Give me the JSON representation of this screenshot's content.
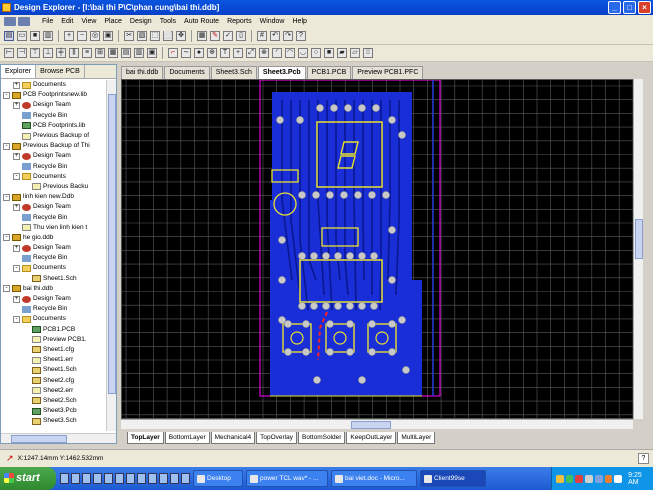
{
  "window": {
    "title": "Design Explorer - [I:\\bai thi P\\C\\phan cung\\bai thi.ddb]",
    "min": "_",
    "max": "□",
    "close": "×"
  },
  "menu": [
    "File",
    "Edit",
    "View",
    "Place",
    "Design",
    "Tools",
    "Auto Route",
    "Reports",
    "Window",
    "Help"
  ],
  "panel": {
    "tabs": [
      "Explorer",
      "Browse PCB"
    ],
    "tree": [
      {
        "indent": 1,
        "exp": "+",
        "icon": "folder",
        "label": "Documents"
      },
      {
        "indent": 0,
        "exp": "-",
        "icon": "ddb",
        "label": "PCB Footprintsnew.lib"
      },
      {
        "indent": 1,
        "exp": "+",
        "icon": "team",
        "label": "Design Team"
      },
      {
        "indent": 1,
        "exp": "",
        "icon": "bin",
        "label": "Recycle Bin"
      },
      {
        "indent": 1,
        "exp": "",
        "icon": "pcb",
        "label": "PCB Footprints.lib"
      },
      {
        "indent": 1,
        "exp": "",
        "icon": "doc",
        "label": "Previous Backup of"
      },
      {
        "indent": 0,
        "exp": "-",
        "icon": "ddb",
        "label": "Previous Backup of Thi"
      },
      {
        "indent": 1,
        "exp": "+",
        "icon": "team",
        "label": "Design Team"
      },
      {
        "indent": 1,
        "exp": "",
        "icon": "bin",
        "label": "Recycle Bin"
      },
      {
        "indent": 1,
        "exp": "-",
        "icon": "folder",
        "label": "Documents"
      },
      {
        "indent": 2,
        "exp": "",
        "icon": "doc",
        "label": "Previous Backu"
      },
      {
        "indent": 0,
        "exp": "-",
        "icon": "ddb",
        "label": "linh kien new.Ddb"
      },
      {
        "indent": 1,
        "exp": "+",
        "icon": "team",
        "label": "Design Team"
      },
      {
        "indent": 1,
        "exp": "",
        "icon": "bin",
        "label": "Recycle Bin"
      },
      {
        "indent": 1,
        "exp": "",
        "icon": "doc",
        "label": "Thu vien linh kien t"
      },
      {
        "indent": 0,
        "exp": "-",
        "icon": "ddb",
        "label": "he gio.ddb"
      },
      {
        "indent": 1,
        "exp": "+",
        "icon": "team",
        "label": "Design Team"
      },
      {
        "indent": 1,
        "exp": "",
        "icon": "bin",
        "label": "Recycle Bin"
      },
      {
        "indent": 1,
        "exp": "-",
        "icon": "folder",
        "label": "Documents"
      },
      {
        "indent": 2,
        "exp": "",
        "icon": "sch",
        "label": "Sheet1.Sch"
      },
      {
        "indent": 0,
        "exp": "-",
        "icon": "ddb",
        "label": "bai thi.ddb"
      },
      {
        "indent": 1,
        "exp": "+",
        "icon": "team",
        "label": "Design Team"
      },
      {
        "indent": 1,
        "exp": "",
        "icon": "bin",
        "label": "Recycle Bin"
      },
      {
        "indent": 1,
        "exp": "-",
        "icon": "folder",
        "label": "Documents"
      },
      {
        "indent": 2,
        "exp": "",
        "icon": "pcb",
        "label": "PCB1.PCB"
      },
      {
        "indent": 2,
        "exp": "",
        "icon": "doc",
        "label": "Preview PCB1."
      },
      {
        "indent": 2,
        "exp": "",
        "icon": "sch",
        "label": "Sheet1.cfg"
      },
      {
        "indent": 2,
        "exp": "",
        "icon": "doc",
        "label": "Sheet1.err"
      },
      {
        "indent": 2,
        "exp": "",
        "icon": "sch",
        "label": "Sheet1.Sch"
      },
      {
        "indent": 2,
        "exp": "",
        "icon": "sch",
        "label": "Sheet2.cfg"
      },
      {
        "indent": 2,
        "exp": "",
        "icon": "doc",
        "label": "Sheet2.err"
      },
      {
        "indent": 2,
        "exp": "",
        "icon": "sch",
        "label": "Sheet2.Sch"
      },
      {
        "indent": 2,
        "exp": "",
        "icon": "pcb",
        "label": "Sheet3.Pcb"
      },
      {
        "indent": 2,
        "exp": "",
        "icon": "sch",
        "label": "Sheet3.Sch"
      }
    ]
  },
  "doc_tabs": [
    "bai thi.ddb",
    "Documents",
    "Sheet3.Sch",
    "Sheet3.Pcb",
    "PCB1.PCB",
    "Preview PCB1.PFC"
  ],
  "active_doc_tab": 3,
  "layer_tabs": [
    "TopLayer",
    "BottomLayer",
    "Mechanical4",
    "TopOverlay",
    "BottomSolder",
    "KeepOutLayer",
    "MultiLayer"
  ],
  "status": {
    "coords": "X:1247.14mm Y:1462.532mm"
  },
  "taskbar": {
    "start": "start",
    "items": [
      "Desktop",
      "power TCL wav* - ...",
      "bai viet.doc - Micro...",
      "Client99se"
    ],
    "time": "9:25 AM"
  },
  "colors": {
    "board_trace": "#1a2ed8",
    "overlay": "#e8e030",
    "pad": "#c8c8c8",
    "keepout": "#ff00ff",
    "grid": "#5a5a5a"
  }
}
